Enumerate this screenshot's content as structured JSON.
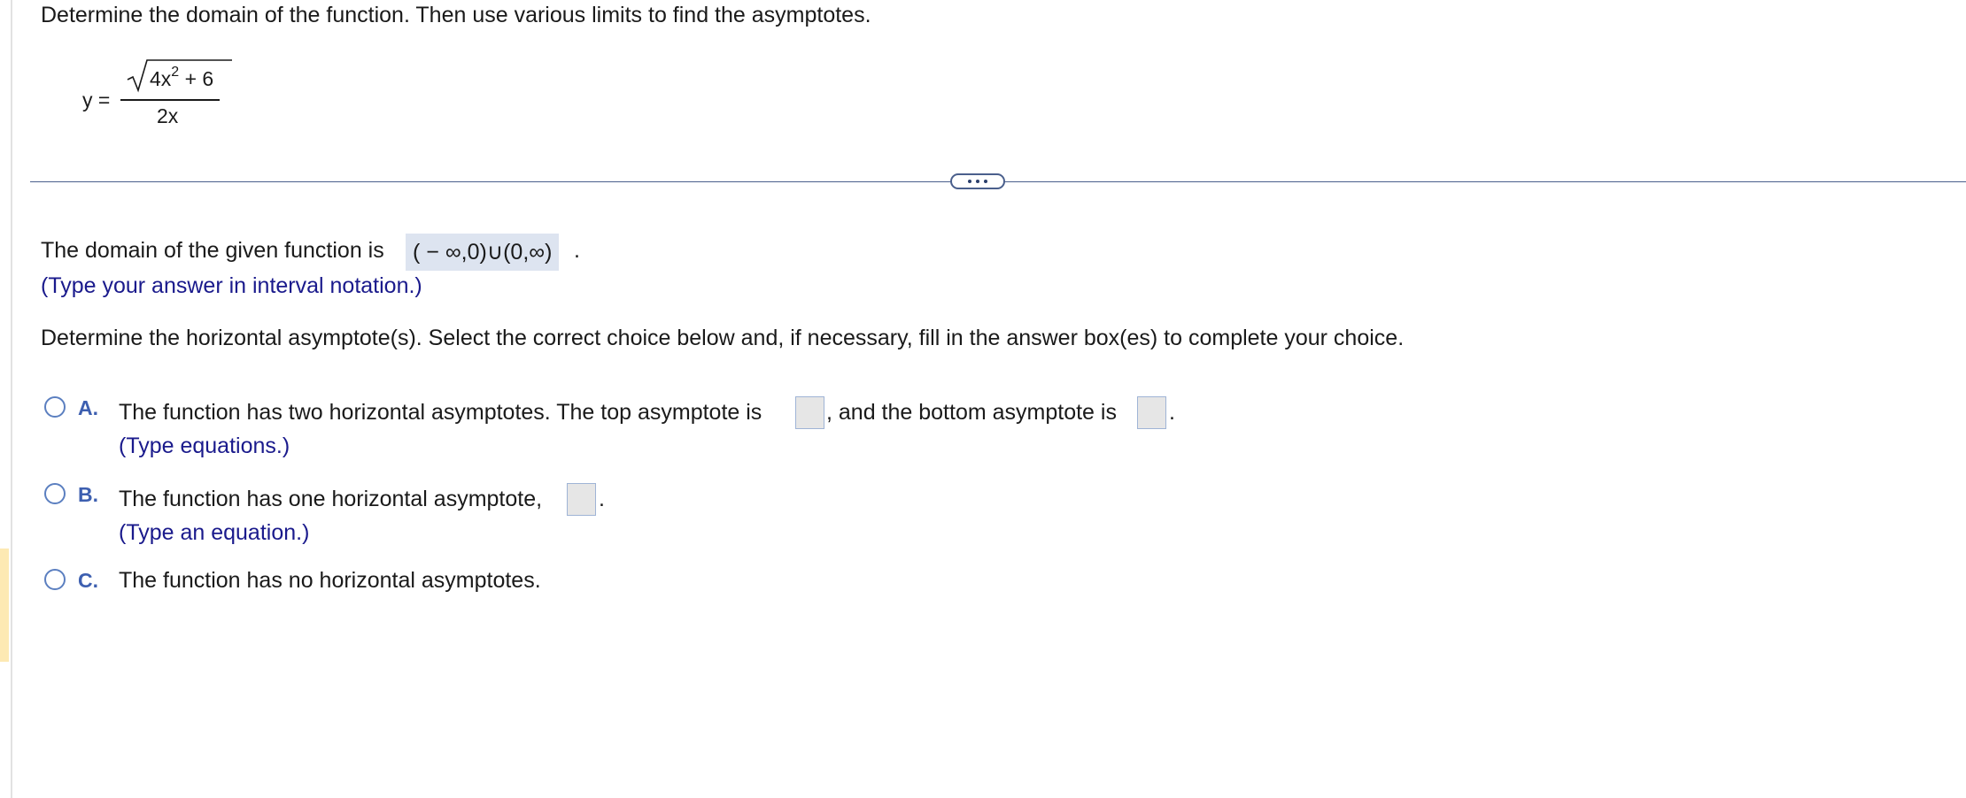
{
  "question": {
    "instruction": "Determine the domain of the function. Then use various limits to find the asymptotes.",
    "function": {
      "lhs": "y =",
      "numerator": "4x",
      "exponent": "2",
      "numerator_tail": " + 6",
      "denominator": "2x"
    }
  },
  "domain_part": {
    "prompt": "The domain of the given function is",
    "answer": "( − ∞,0)∪(0,∞)",
    "period": ".",
    "hint": "(Type your answer in interval notation.)"
  },
  "horizontal_part": {
    "prompt": "Determine the horizontal asymptote(s). Select the correct choice below and, if necessary, fill in the answer box(es) to complete your choice.",
    "choices": [
      {
        "letter": "A.",
        "text_1": "The function has two horizontal asymptotes. The top asymptote is",
        "text_2": ", and the bottom asymptote is",
        "text_end": ".",
        "hint": "(Type equations.)"
      },
      {
        "letter": "B.",
        "text_1": "The function has one horizontal asymptote,",
        "text_end": ".",
        "hint": "(Type an equation.)"
      },
      {
        "letter": "C.",
        "text_1": "The function has no horizontal asymptotes."
      }
    ]
  },
  "colors": {
    "accent": "#3d5fb0",
    "hint_text": "#1a1a8c",
    "answer_box_bg": "#dde4f0",
    "left_accent": "#fde9b3"
  }
}
